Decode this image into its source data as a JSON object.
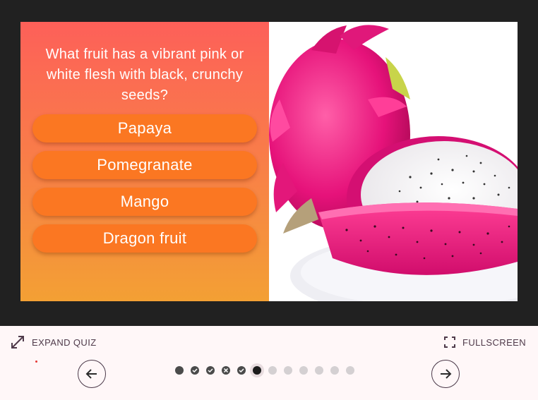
{
  "quiz": {
    "question": "What fruit has a vibrant pink or white flesh with black, crunchy seeds?",
    "answers": [
      "Papaya",
      "Pomegranate",
      "Mango",
      "Dragon fruit"
    ]
  },
  "toolbar": {
    "expand_label": "EXPAND QUIZ",
    "fullscreen_label": "FULLSCREEN"
  },
  "progress": {
    "total": 12,
    "current": 6,
    "statuses": [
      "answered",
      "correct",
      "correct",
      "incorrect",
      "correct",
      "current",
      "pending",
      "pending",
      "pending",
      "pending",
      "pending",
      "pending"
    ]
  },
  "colors": {
    "answer_button": "#fb7722",
    "gradient_top": "#fd6059",
    "gradient_bottom": "#f3a034",
    "bar_background": "#fff7f8"
  }
}
